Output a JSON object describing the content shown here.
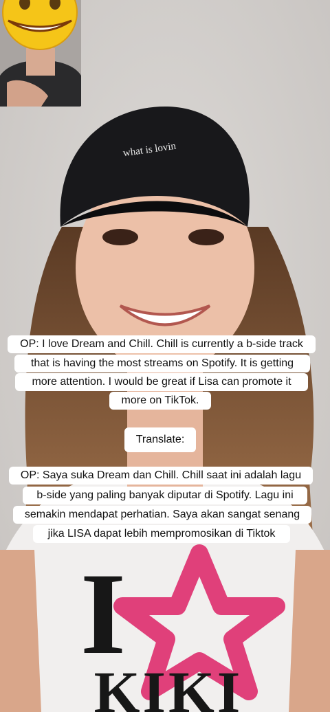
{
  "captions": {
    "english_lines": [
      "OP: I love Dream and Chill. Chill is currently a b-side track",
      "that is having the most streams on Spotify. It is getting",
      "more attention. I would be great if Lisa can promote it",
      "more on TikTok."
    ],
    "translate_label": "Translate:",
    "indonesian_lines": [
      "OP: Saya suka Dream dan Chill. Chill saat ini adalah lagu",
      "b-side yang paling banyak diputar di Spotify. Lagu ini",
      "semakin mendapat perhatian. Saya akan sangat senang",
      "jika LISA dapat lebih mempromosikan di Tiktok"
    ]
  },
  "cap": {
    "text": "what is lovin"
  },
  "shirt": {
    "letter": "I",
    "word": "KIKI",
    "star_color": "#e0407a"
  },
  "pip": {
    "emoji": "grinning-face-emoji"
  },
  "colors": {
    "background": "#d6d3d0",
    "caption_bg": "#ffffff",
    "caption_text": "#111111"
  }
}
